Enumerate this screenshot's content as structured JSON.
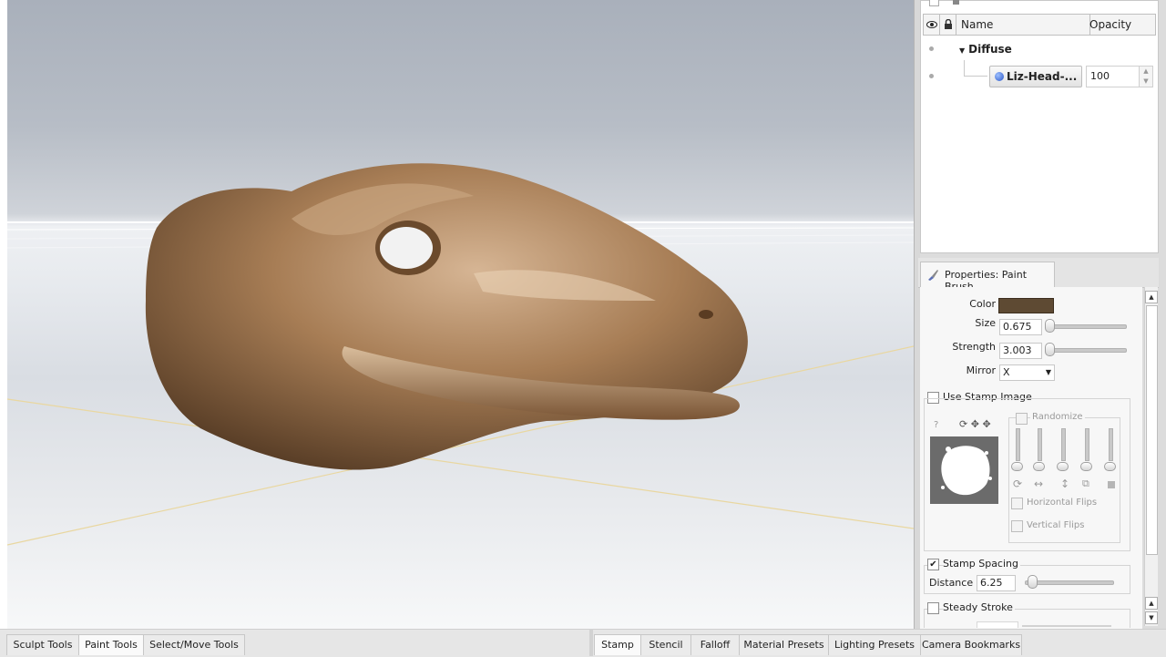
{
  "layers": {
    "header": {
      "name": "Name",
      "opacity": "Opacity"
    },
    "group_label": "Diffuse",
    "layer_label": "Liz-Head-...",
    "opacity_value": "100"
  },
  "properties": {
    "tab_label": "Properties: Paint Brush",
    "color_label": "Color",
    "color_value": "#5e4a33",
    "size_label": "Size",
    "size_value": "0.675",
    "strength_label": "Strength",
    "strength_value": "3.003",
    "mirror_label": "Mirror",
    "mirror_value": "X",
    "use_stamp_image": "Use Stamp Image",
    "randomize": "Randomize",
    "horizontal_flips": "Horizontal Flips",
    "vertical_flips": "Vertical Flips",
    "help_mark": "?",
    "stamp_spacing": "Stamp Spacing",
    "distance_label": "Distance",
    "distance_value": "6.25",
    "steady_stroke": "Steady Stroke"
  },
  "bottom_tabs_left": [
    "Sculpt Tools",
    "Paint Tools",
    "Select/Move Tools"
  ],
  "bottom_tabs_right": [
    "Stamp",
    "Stencil",
    "Falloff",
    "Material Presets",
    "Lighting Presets",
    "Camera Bookmarks"
  ],
  "icons": [
    "eye-icon",
    "lock-icon",
    "paint-brush-icon",
    "globe-icon",
    "rotate-icon",
    "move-icon",
    "scale-icon",
    "flip-icon",
    "transform-icon"
  ]
}
